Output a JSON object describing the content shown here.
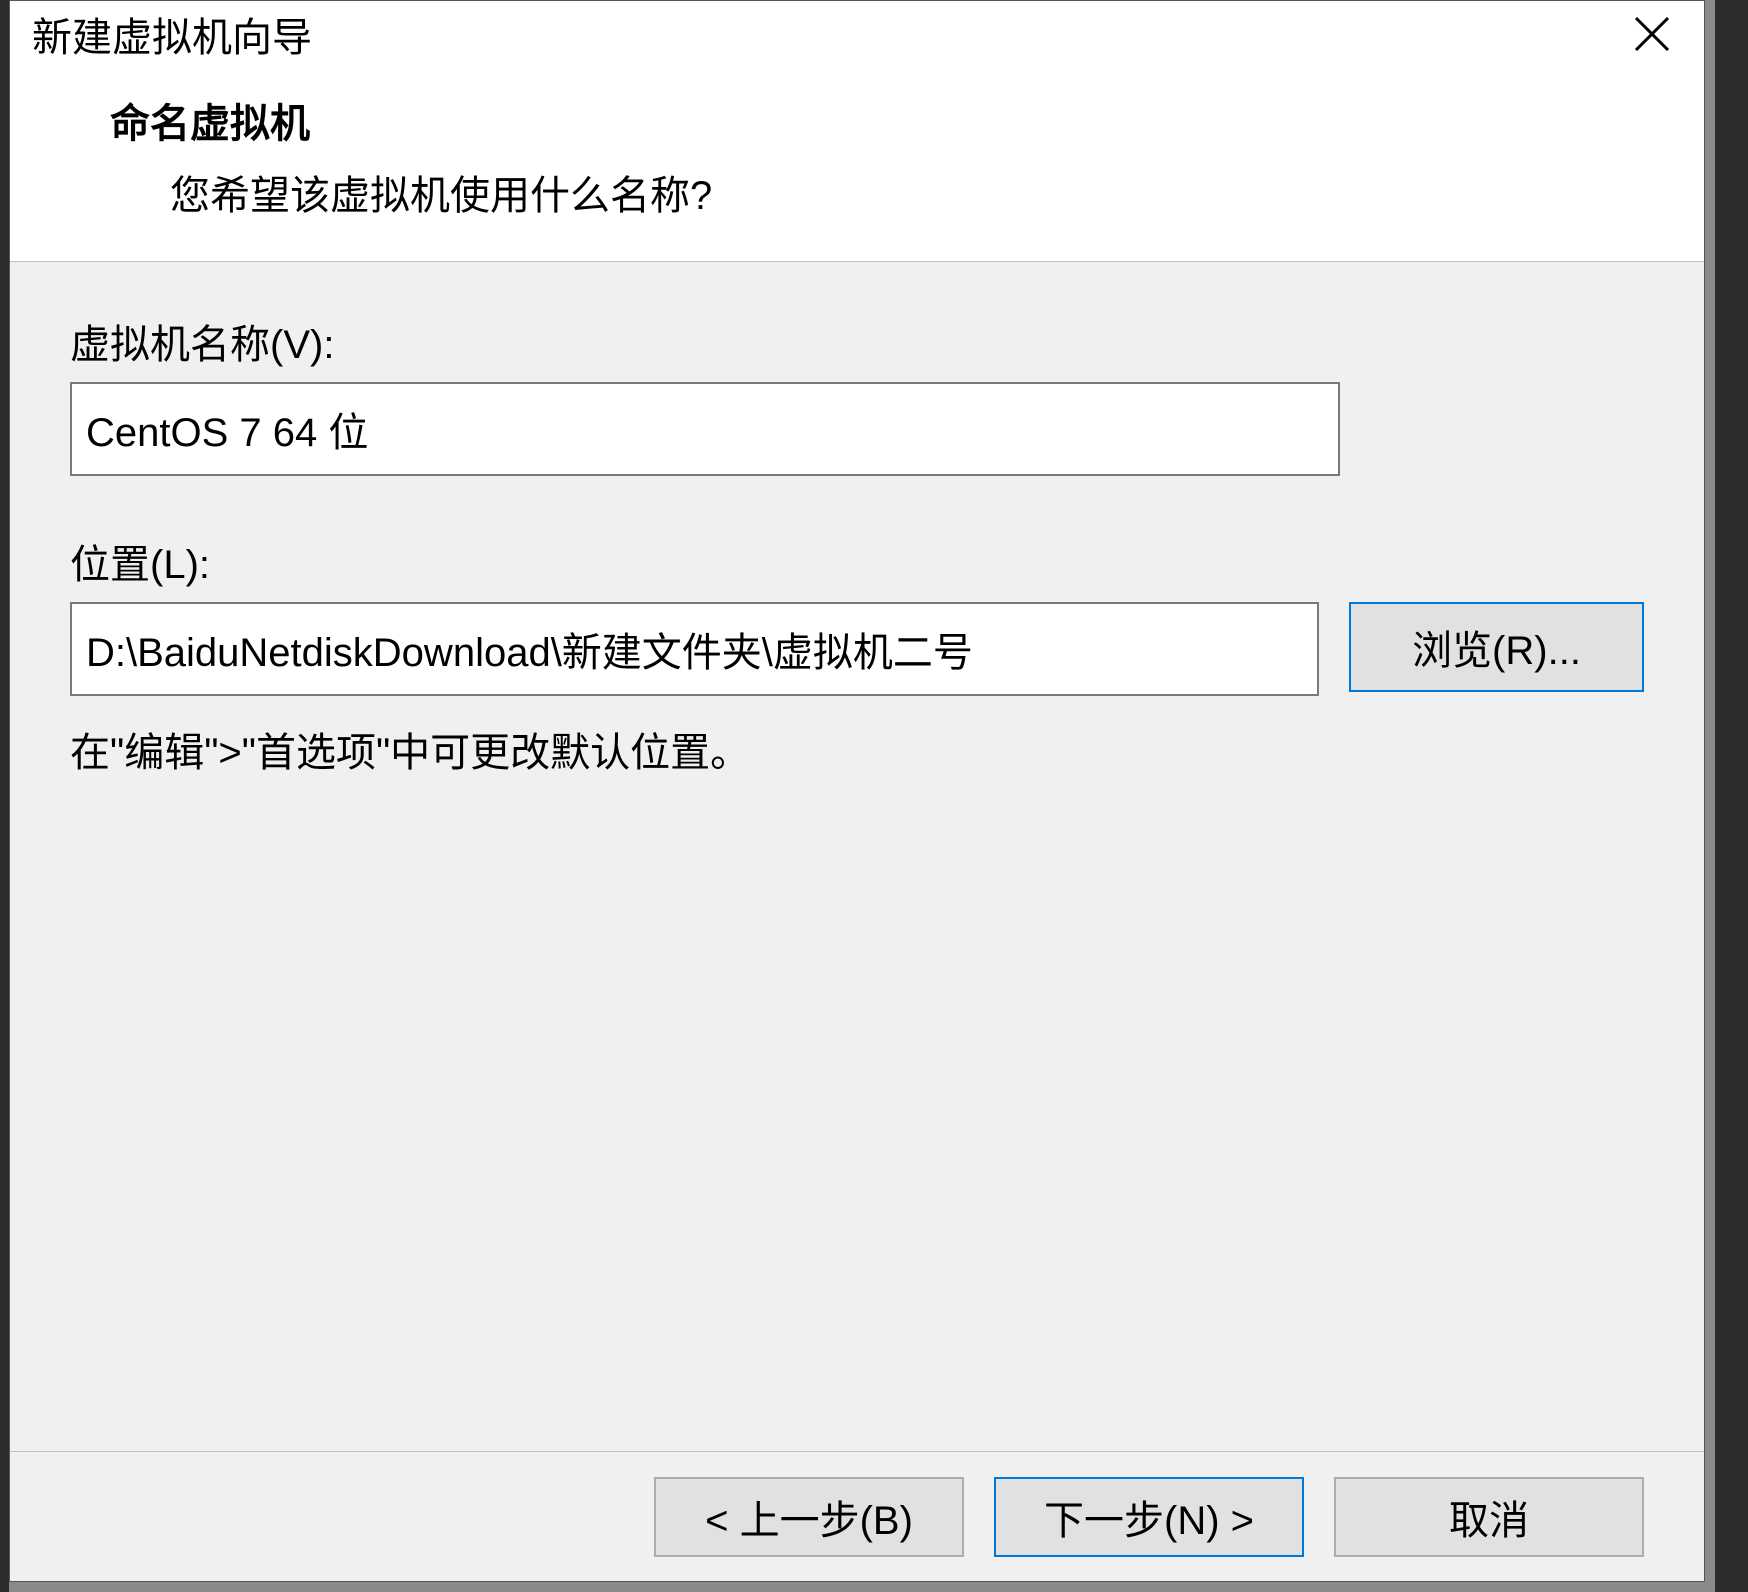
{
  "window": {
    "title": "新建虚拟机向导"
  },
  "header": {
    "title": "命名虚拟机",
    "subtitle": "您希望该虚拟机使用什么名称?"
  },
  "form": {
    "name_label": "虚拟机名称(V):",
    "name_value": "CentOS 7 64 位",
    "location_label": "位置(L):",
    "location_value": "D:\\BaiduNetdiskDownload\\新建文件夹\\虚拟机二号",
    "browse_label": "浏览(R)...",
    "hint": "在\"编辑\">\"首选项\"中可更改默认位置。"
  },
  "footer": {
    "back_label": "< 上一步(B)",
    "next_label": "下一步(N) >",
    "cancel_label": "取消"
  }
}
